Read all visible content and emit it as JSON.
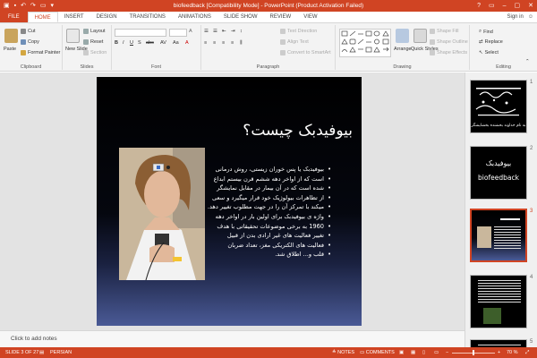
{
  "window": {
    "title": "biofeedback [Compatibility Mode] - PowerPoint (Product Activation Failed)",
    "controls": [
      "?",
      "▭",
      "–",
      "▢",
      "✕"
    ]
  },
  "tabs": [
    {
      "label": "FILE"
    },
    {
      "label": "HOME"
    },
    {
      "label": "INSERT"
    },
    {
      "label": "DESIGN"
    },
    {
      "label": "TRANSITIONS"
    },
    {
      "label": "ANIMATIONS"
    },
    {
      "label": "SLIDE SHOW"
    },
    {
      "label": "REVIEW"
    },
    {
      "label": "VIEW"
    }
  ],
  "signin": "Sign in",
  "ribbon": {
    "clipboard": {
      "paste": "Paste",
      "cut": "Cut",
      "copy": "Copy",
      "format_painter": "Format Painter",
      "label": "Clipboard"
    },
    "slides": {
      "new_slide": "New Slide",
      "layout": "Layout",
      "reset": "Reset",
      "section": "Section",
      "label": "Slides"
    },
    "font": {
      "label": "Font"
    },
    "paragraph": {
      "text_direction": "Text Direction",
      "align_text": "Align Text",
      "convert": "Convert to SmartArt",
      "label": "Paragraph"
    },
    "drawing": {
      "arrange": "Arrange",
      "quick_styles": "Quick Styles",
      "shape_fill": "Shape Fill",
      "shape_outline": "Shape Outline",
      "shape_effects": "Shape Effects",
      "label": "Drawing"
    },
    "editing": {
      "find": "Find",
      "replace": "Replace",
      "select": "Select",
      "label": "Editing"
    }
  },
  "slide": {
    "title": "بیوفیدبک چیست؟",
    "bullets": [
      "بیوفیدبک یا پس خوران زیستی، روش درمانی",
      "است که از اواخر دهه ششم قرن بیستم ابداع",
      "شده است که در آن بیمار در مقابل نمایشگر",
      "از تظاهرات بیولوژیک خود قرار میگیرد و سعی",
      "میکند با تمرکز آن را در جهت مطلوب تغییر دهد.",
      "واژه ی بیوفیدبک برای اولین بار در اواخر دهه",
      "1960 به برخی موضوعات تحقیقاتی با هدف",
      "تغییر فعالیت های غیر ارادی بدن از قبیل",
      "فعالیت های الکتریکی مغز، تعداد ضربان",
      "قلب و... اطلاق شد."
    ]
  },
  "notes_placeholder": "Click to add notes",
  "thumbnails": [
    {
      "number": "1",
      "text": "به نام خداوند بخشنده بخشایشگر"
    },
    {
      "number": "2",
      "text": "بیوفیدبک",
      "text2": "biofeedback"
    },
    {
      "number": "3"
    },
    {
      "number": "4"
    },
    {
      "number": "5"
    }
  ],
  "status": {
    "slide_info": "SLIDE 3 OF 27",
    "language": "PERSIAN",
    "notes": "NOTES",
    "comments": "COMMENTS",
    "zoom": "70 %"
  },
  "colors": {
    "accent": "#d04423"
  }
}
